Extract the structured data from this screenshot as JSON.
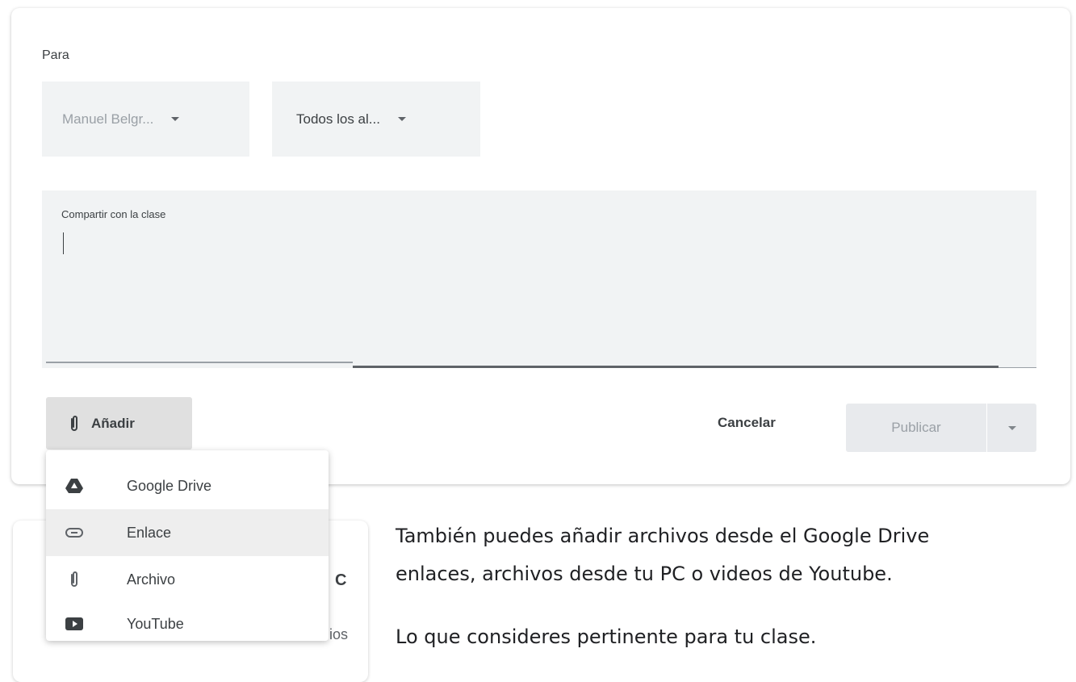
{
  "form": {
    "para_label": "Para",
    "class_select": "Manuel Belgr...",
    "students_select": "Todos los al...",
    "share_label": "Compartir con la clase"
  },
  "actions": {
    "add_label": "Añadir",
    "cancel_label": "Cancelar",
    "publish_label": "Publicar"
  },
  "attach_menu": {
    "items": [
      {
        "label": "Google Drive",
        "icon": "google-drive-icon"
      },
      {
        "label": "Enlace",
        "icon": "link-icon"
      },
      {
        "label": "Archivo",
        "icon": "paperclip-icon"
      },
      {
        "label": "YouTube",
        "icon": "youtube-icon"
      }
    ],
    "highlighted": "Enlace"
  },
  "background_card": {
    "peek_letter": "C",
    "peek_text": "ios"
  },
  "explanation": {
    "line1": "También puedes añadir archivos desde el Google Drive",
    "line2": "enlaces, archivos desde tu PC o videos de Youtube.",
    "line3": "Lo que consideres pertinente para tu clase."
  }
}
